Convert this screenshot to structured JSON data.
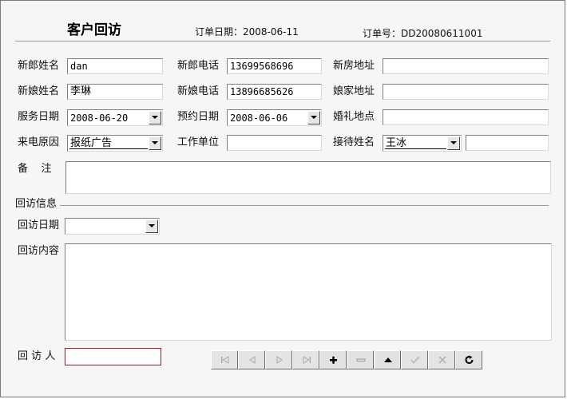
{
  "header": {
    "title": "客户回访",
    "order_date": "订单日期：2008-06-11",
    "order_no": "订单号：DD20080611001"
  },
  "form": {
    "groom_name_label": "新郎姓名",
    "groom_name": "dan",
    "groom_phone_label": "新郎电话",
    "groom_phone": "13699568696",
    "new_house_label": "新房地址",
    "new_house": "",
    "bride_name_label": "新娘姓名",
    "bride_name": "李琳",
    "bride_phone_label": "新娘电话",
    "bride_phone": "13896685626",
    "bride_home_label": "娘家地址",
    "bride_home": "",
    "service_date_label": "服务日期",
    "service_date": "2008-06-20",
    "appt_date_label": "预约日期",
    "appt_date": "2008-06-06",
    "wedding_place_label": "婚礼地点",
    "wedding_place": "",
    "reason_label": "来电原因",
    "reason": "报纸广告",
    "work_unit_label": "工作单位",
    "work_unit": "",
    "receptionist_label": "接待姓名",
    "receptionist": "王冰",
    "receptionist_extra": "",
    "remarks_label": "备    注"
  },
  "followup": {
    "section_label": "回访信息",
    "date_label": "回访日期",
    "date": "",
    "content_label": "回访内容",
    "visitor_label": "回 访 人",
    "visitor": ""
  },
  "navigator": {
    "buttons": [
      "first",
      "prior",
      "next",
      "last",
      "insert",
      "delete",
      "edit",
      "post",
      "cancel",
      "refresh"
    ]
  }
}
